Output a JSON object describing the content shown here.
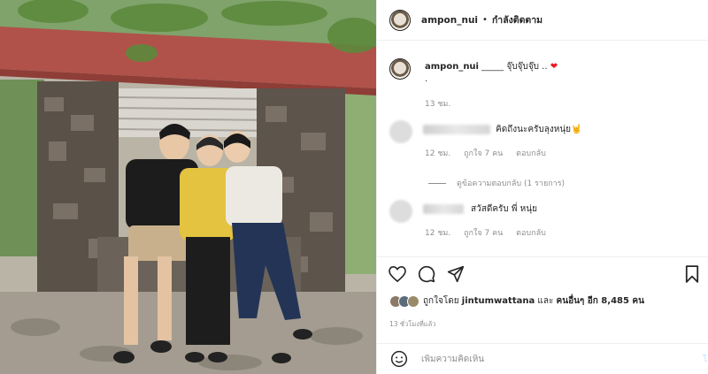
{
  "header": {
    "username": "ampon_nui",
    "separator": "•",
    "follow_status": "กำลังติดตาม"
  },
  "caption": {
    "username": "ampon_nui",
    "text": " _____ จุ๊บจุ๊บจุ๊บ .. ",
    "heart": "❤",
    "second_line": ".",
    "time": "13 ชม."
  },
  "comments": [
    {
      "text": "คิดถึงนะครับลุงหนุ่ย🤘",
      "time": "12 ชม.",
      "likes": "ถูกใจ 7 คน",
      "reply": "ตอบกลับ"
    },
    {
      "text": "สวัสดีครับ พี่ หนุ่ย",
      "time": "12 ชม.",
      "likes": "ถูกใจ 7 คน",
      "reply": "ตอบกลับ"
    }
  ],
  "view_replies": "ดูข้อความตอบกลับ (1 รายการ)",
  "likes_summary": {
    "prefix": "ถูกใจโดย ",
    "first_user": "jintumwattana",
    "middle": " และ ",
    "others": "คนอื่นๆ อีก 8,485 คน"
  },
  "posted_ago": "13 ชั่วโมงที่แล้ว",
  "add_comment": {
    "placeholder": "เพิ่มความคิดเห็น",
    "post_label": "โ"
  },
  "icons": [
    "heart-icon",
    "comment-icon",
    "share-icon",
    "bookmark-icon",
    "emoji-icon"
  ],
  "colors": {
    "accent_heart": "#ed1c24",
    "muted_text": "#8e8e8e",
    "post_button": "#b3dbff"
  }
}
